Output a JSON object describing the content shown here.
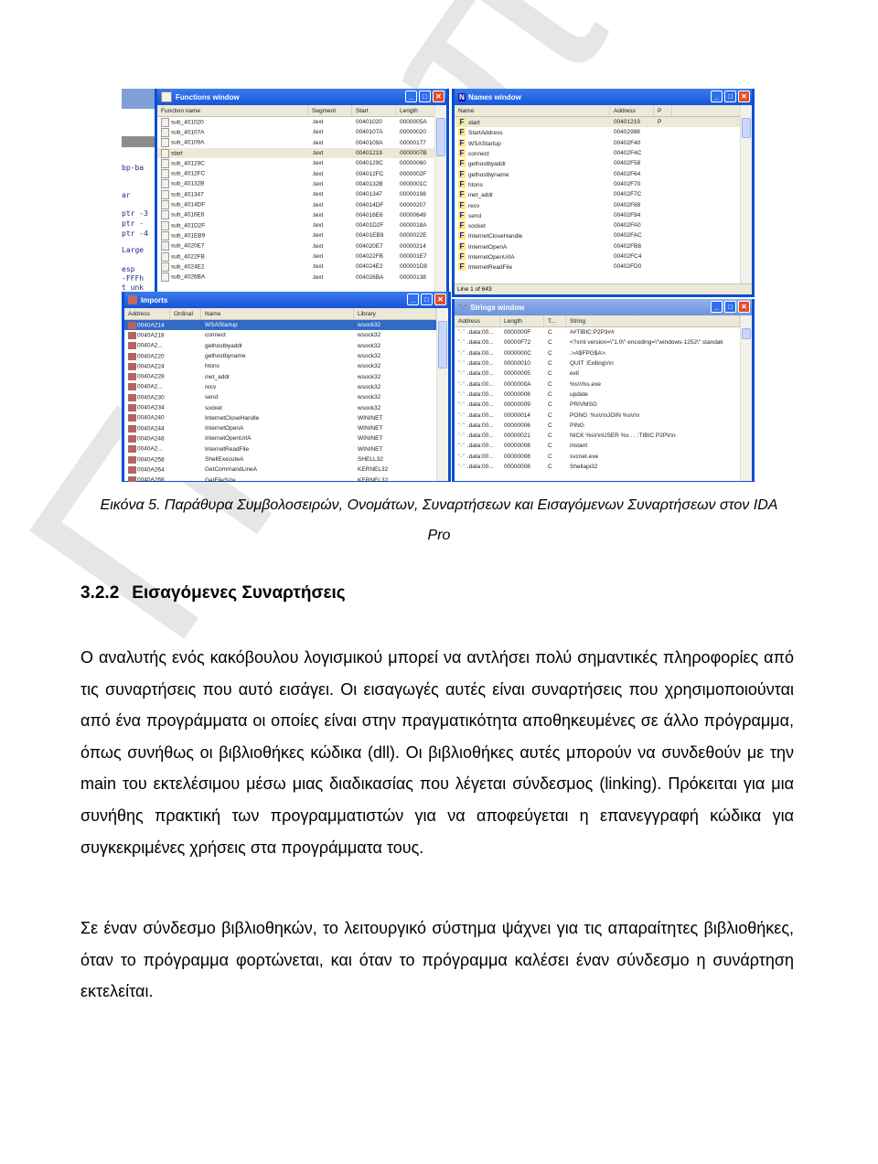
{
  "watermark": "Πανεπιστήμιο",
  "figure": {
    "background_view": {
      "code_lines": [
        "bp-ba",
        "ar",
        "ptr -3",
        " ptr -",
        "ptr -4",
        "Large",
        "esp",
        "-FFFh",
        "t unk"
      ]
    },
    "functions_window": {
      "title": "Functions window",
      "columns": [
        "Function name",
        "Segment",
        "Start",
        "Length"
      ],
      "rows": [
        [
          "sub_401020",
          ".text",
          "00401020",
          "0000005A"
        ],
        [
          "sub_40107A",
          ".text",
          "0040107A",
          "00000020"
        ],
        [
          "sub_40109A",
          ".text",
          "0040109A",
          "00000177"
        ],
        [
          "start",
          ".text",
          "00401219",
          "0000007B"
        ],
        [
          "sub_40129C",
          ".text",
          "0040129C",
          "00000060"
        ],
        [
          "sub_4012FC",
          ".text",
          "004012FC",
          "0000002F"
        ],
        [
          "sub_40132B",
          ".text",
          "0040132B",
          "0000001C"
        ],
        [
          "sub_401347",
          ".text",
          "00401347",
          "00000198"
        ],
        [
          "sub_4014DF",
          ".text",
          "004014DF",
          "00000207"
        ],
        [
          "sub_4016E6",
          ".text",
          "004016E6",
          "00000649"
        ],
        [
          "sub_401D2F",
          ".text",
          "00401D2F",
          "0000018A"
        ],
        [
          "sub_401EB9",
          ".text",
          "00401EB9",
          "0000022E"
        ],
        [
          "sub_4020E7",
          ".text",
          "004020E7",
          "00000214"
        ],
        [
          "sub_4022FB",
          ".text",
          "004022FB",
          "000001E7"
        ],
        [
          "sub_4024E2",
          ".text",
          "004024E2",
          "000001D8"
        ],
        [
          "sub_4026BA",
          ".text",
          "004026BA",
          "00000138"
        ]
      ]
    },
    "imports_window": {
      "title": "Imports",
      "columns": [
        "Address",
        "Ordinal",
        "Name",
        "Library"
      ],
      "rows": [
        [
          "0040A214",
          "",
          "WSAStartup",
          "wsock32"
        ],
        [
          "0040A218",
          "",
          "connect",
          "wsock32"
        ],
        [
          "0040A2...",
          "",
          "gethostbyaddr",
          "wsock32"
        ],
        [
          "0040A220",
          "",
          "gethostbyname",
          "wsock32"
        ],
        [
          "0040A224",
          "",
          "htons",
          "wsock32"
        ],
        [
          "0040A228",
          "",
          "inet_addr",
          "wsock32"
        ],
        [
          "0040A2...",
          "",
          "recv",
          "wsock32"
        ],
        [
          "0040A230",
          "",
          "send",
          "wsock32"
        ],
        [
          "0040A234",
          "",
          "socket",
          "wsock32"
        ],
        [
          "0040A240",
          "",
          "InternetCloseHandle",
          "WININET"
        ],
        [
          "0040A244",
          "",
          "InternetOpenA",
          "WININET"
        ],
        [
          "0040A248",
          "",
          "InternetOpenUrlA",
          "WININET"
        ],
        [
          "0040A2...",
          "",
          "InternetReadFile",
          "WININET"
        ],
        [
          "0040A258",
          "",
          "ShellExecuteA",
          "SHELL32"
        ],
        [
          "0040A264",
          "",
          "GetCommandLineA",
          "KERNEL32"
        ],
        [
          "0040A268",
          "",
          "GetFileSize",
          "KERNEL32"
        ]
      ]
    },
    "names_window": {
      "title": "Names window",
      "columns": [
        "Name",
        "Address",
        "P"
      ],
      "rows": [
        [
          "start",
          "00401219",
          "P"
        ],
        [
          "StartAddress",
          "00402998",
          ""
        ],
        [
          "WSAStartup",
          "00402F40",
          ""
        ],
        [
          "connect",
          "00402F4C",
          ""
        ],
        [
          "gethostbyaddr",
          "00402F58",
          ""
        ],
        [
          "gethostbyname",
          "00402F64",
          ""
        ],
        [
          "htons",
          "00402F70",
          ""
        ],
        [
          "inet_addr",
          "00402F7C",
          ""
        ],
        [
          "recv",
          "00402F88",
          ""
        ],
        [
          "send",
          "00402F94",
          ""
        ],
        [
          "socket",
          "00402FA0",
          ""
        ],
        [
          "InternetCloseHandle",
          "00402FAC",
          ""
        ],
        [
          "InternetOpenA",
          "00402FB8",
          ""
        ],
        [
          "InternetOpenUrlA",
          "00402FC4",
          ""
        ],
        [
          "InternetReadFile",
          "00402FD0",
          ""
        ]
      ],
      "status": "Line 1 of 643"
    },
    "strings_window": {
      "title": "Strings window",
      "columns": [
        "Address",
        "Length",
        "T...",
        "String"
      ],
      "rows": [
        [
          ".data:00...",
          "0000000F",
          "C",
          "##TIBIC:P2P3##"
        ],
        [
          ".data:00...",
          "00000F72",
          "C",
          "<?xml version=\\\"1.0\\\" encoding=\\\"windows-1252\\\" standak"
        ],
        [
          ".data:00...",
          "0000000C",
          "C",
          ".>A$FPG$A>."
        ],
        [
          ".data:00...",
          "00000010",
          "C",
          "QUIT :Exiting\\r\\n"
        ],
        [
          ".data:00...",
          "00000005",
          "C",
          "exit"
        ],
        [
          ".data:00...",
          "0000000A",
          "C",
          "%s\\\\%s.exe"
        ],
        [
          ".data:00...",
          "00000008",
          "C",
          "update"
        ],
        [
          ".data:00...",
          "00000009",
          "C",
          "PRIVMSG"
        ],
        [
          ".data:00...",
          "00000014",
          "C",
          "PONG :%s\\r\\nJOIN %s\\r\\n"
        ],
        [
          ".data:00...",
          "00000006",
          "C",
          "PING"
        ],
        [
          ".data:00...",
          "00000021",
          "C",
          "NICK %s\\r\\nUSER %s . . :TIBIC P2P\\r\\n"
        ],
        [
          ".data:00...",
          "00000008",
          "C",
          "instant"
        ],
        [
          ".data:00...",
          "00000008",
          "C",
          "svcnet.exe"
        ],
        [
          ".data:00...",
          "00000008",
          "C",
          "Shellapi32"
        ]
      ]
    }
  },
  "caption": {
    "line1": "Εικόνα 5. Παράθυρα Συμβολοσειρών, Ονομάτων, Συναρτήσεων και Εισαγόμενων Συναρτήσεων στον IDA",
    "line2": "Pro"
  },
  "section": {
    "number": "3.2.2",
    "title": "Εισαγόμενες Συναρτήσεις"
  },
  "paragraphs": [
    "Ο αναλυτής ενός κακόβουλου λογισμικού μπορεί να αντλήσει πολύ σημαντικές πληροφορίες από τις συναρτήσεις που αυτό εισάγει. Οι εισαγωγές αυτές είναι συναρτήσεις που χρησιμοποιούνται από ένα προγράμματα οι οποίες είναι στην πραγματικότητα αποθηκευμένες σε άλλο πρόγραμμα, όπως συνήθως οι βιβλιοθήκες κώδικα (dll). Οι βιβλιοθήκες αυτές μπορούν να συνδεθούν με την main του εκτελέσιμου μέσω μιας διαδικασίας που λέγεται σύνδεσμος (linking). Πρόκειται για μια συνήθης πρακτική των προγραμματιστών για να αποφεύγεται η επανεγγραφή κώδικα για συγκεκριμένες χρήσεις στα προγράμματα τους.",
    "Σε έναν σύνδεσμο βιβλιοθηκών, το λειτουργικό σύστημα ψάχνει για τις απαραίτητες βιβλιοθήκες, όταν το πρόγραμμα φορτώνεται, και όταν το πρόγραμμα καλέσει έναν σύνδεσμο η συνάρτηση εκτελείται."
  ]
}
